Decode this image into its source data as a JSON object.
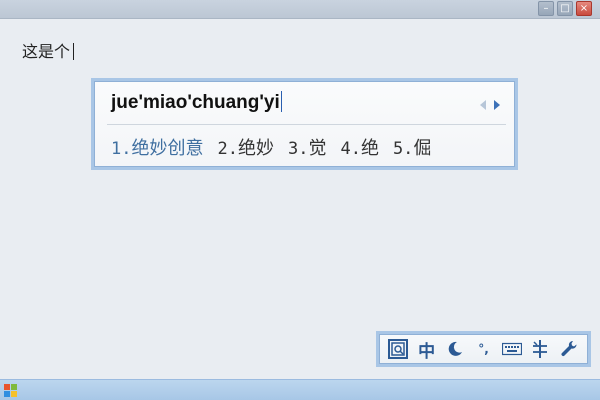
{
  "window": {
    "minimize_glyph": "–",
    "maximize_glyph": "□",
    "close_glyph": "×"
  },
  "editor": {
    "text": "这是个"
  },
  "ime": {
    "composition": "jue'miao'chuang'yi",
    "candidates": [
      {
        "index": "1.",
        "text": "绝妙创意",
        "selected": true
      },
      {
        "index": "2.",
        "text": "绝妙",
        "selected": false
      },
      {
        "index": "3.",
        "text": "觉",
        "selected": false
      },
      {
        "index": "4.",
        "text": "绝",
        "selected": false
      },
      {
        "index": "5.",
        "text": "倔",
        "selected": false
      }
    ],
    "page_controls": [
      "prev-page-arrow-icon",
      "next-page-arrow-icon"
    ]
  },
  "status_bar": {
    "lang_mode": "中",
    "punct_label": "°,",
    "icons": [
      "ime-logo-icon",
      "half-width-moon-icon",
      "punctuation-icon",
      "soft-keyboard-icon",
      "simplified-traditional-icon",
      "settings-wrench-icon"
    ]
  },
  "colors": {
    "accent_blue": "#2c5a94",
    "selected_candidate": "#3f6fa0",
    "panel_border": "#a9c6e6"
  }
}
